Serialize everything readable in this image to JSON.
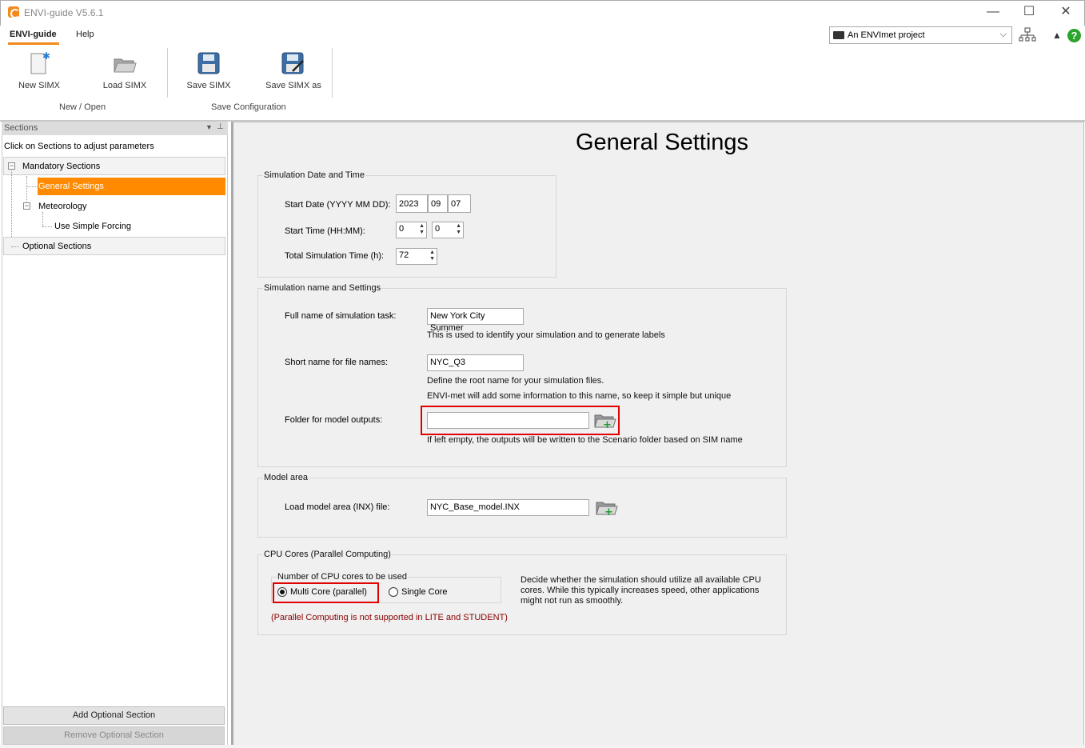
{
  "window": {
    "title": "ENVI-guide V5.6.1",
    "minimize": "—",
    "maximize": "☐",
    "close": "✕"
  },
  "ribbon": {
    "tabs": {
      "main": "ENVI-guide",
      "help": "Help"
    },
    "project_select": "An ENVImet project",
    "buttons": {
      "new": "New SIMX",
      "load": "Load SIMX",
      "save": "Save SIMX",
      "save_as": "Save SIMX as"
    },
    "groups": {
      "new_open": "New / Open",
      "save_config": "Save Configuration"
    }
  },
  "sidebar": {
    "header": "Sections",
    "hint": "Click on Sections to adjust parameters",
    "mandatory": "Mandatory Sections",
    "general": "General Settings",
    "meteorology": "Meteorology",
    "forcing": "Use Simple Forcing",
    "optional": "Optional Sections",
    "add_btn": "Add Optional Section",
    "remove_btn": "Remove Optional Section"
  },
  "main": {
    "title": "General Settings",
    "datetime": {
      "group": "Simulation Date and Time",
      "start_date_label": "Start Date (YYYY MM DD):",
      "year": "2023",
      "month": "09",
      "day": "07",
      "start_time_label": "Start Time (HH:MM):",
      "hour": "0",
      "minute": "0",
      "total_label": "Total Simulation Time (h):",
      "total": "72"
    },
    "name": {
      "group": "Simulation name and Settings",
      "full_label": "Full name of simulation task:",
      "full_value": "New York City Summer",
      "full_hint": "This is used to identify your simulation and to generate labels",
      "short_label": "Short name for file names:",
      "short_value": "NYC_Q3",
      "short_hint1": "Define the root name for your simulation files.",
      "short_hint2": "ENVI-met will add some information to this name, so keep it simple but unique",
      "folder_label": "Folder for model outputs:",
      "folder_value": "",
      "folder_hint": "If left empty, the outputs will be written to the Scenario folder based on SIM name"
    },
    "model": {
      "group": "Model area",
      "label": "Load model area (INX) file:",
      "value": "NYC_Base_model.INX"
    },
    "cpu": {
      "group": "CPU Cores (Parallel Computing)",
      "sub_group": "Number of CPU cores to be used",
      "multi": "Multi Core (parallel)",
      "single": "Single Core",
      "selected": "Multi Core (parallel)",
      "desc1": "Decide whether the simulation should utilize all available CPU",
      "desc2": "cores. While this typically increases speed, other applications",
      "desc3": "might not run as smoothly.",
      "note": "(Parallel Computing is not supported in LITE and STUDENT)"
    }
  },
  "colors": {
    "accent": "#ff8a00",
    "highlight_box": "#e00000",
    "help_green": "#2aa42a",
    "note_red": "#8b0000"
  }
}
